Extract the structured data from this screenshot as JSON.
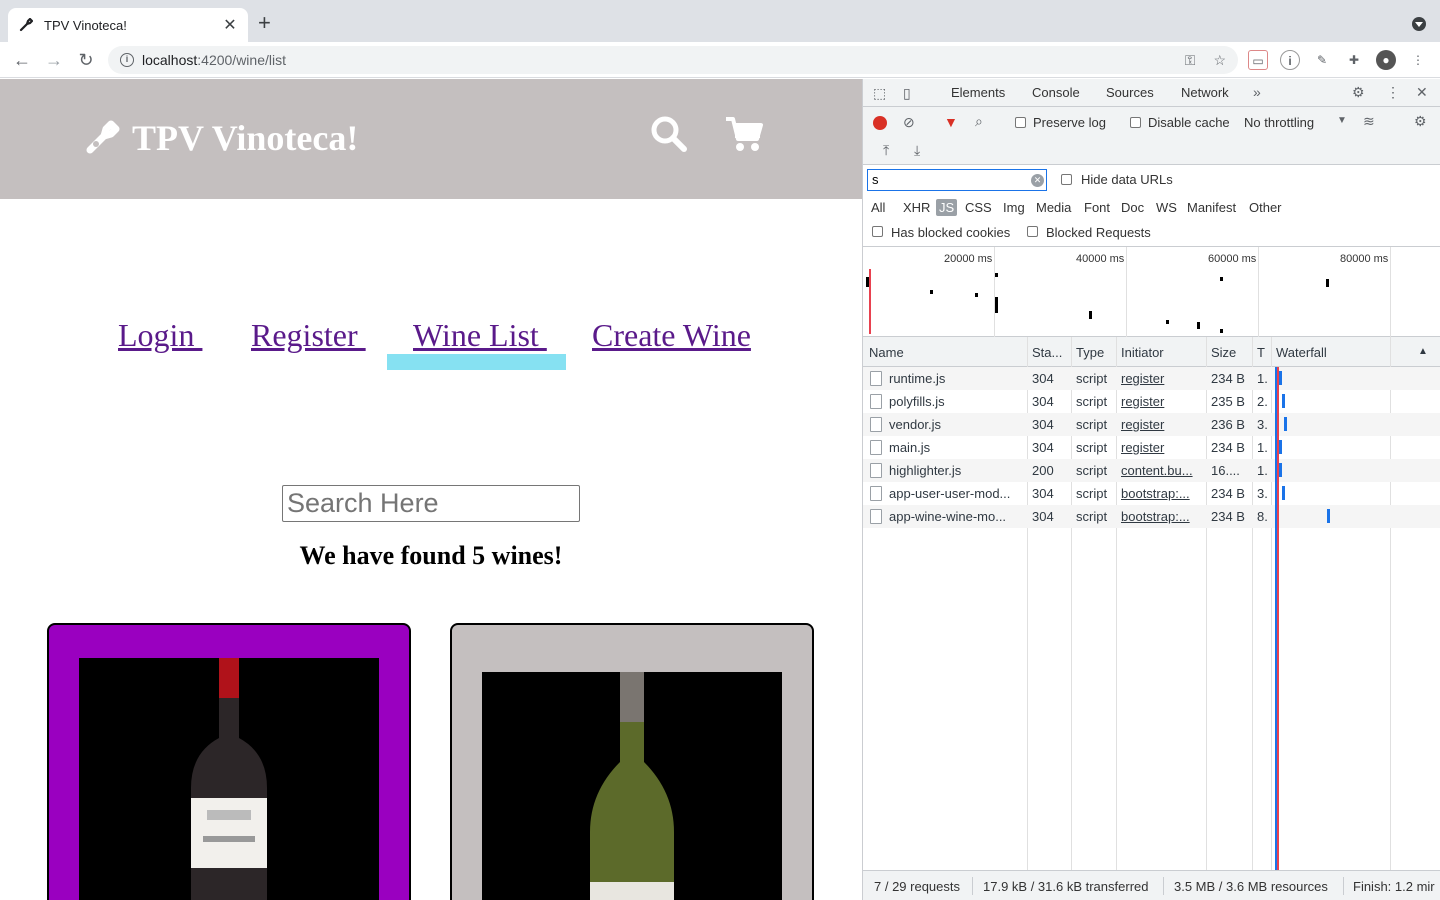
{
  "browser": {
    "tab_title": "TPV Vinoteca!",
    "url_host": "localhost",
    "url_path": ":4200/wine/list"
  },
  "site": {
    "brand": "TPV Vinoteca!",
    "nav": [
      "Login ",
      "Register ",
      "Wine List ",
      "Create Wine"
    ],
    "search_placeholder": "Search Here",
    "found_text": "We have found 5 wines!",
    "cards": [
      {
        "border": "#9a00c0"
      },
      {
        "border": "#c4bfbf"
      }
    ]
  },
  "devtools": {
    "tabs": [
      "Elements",
      "Console",
      "Sources",
      "Network"
    ],
    "active_tab": "Network",
    "preserve_log": "Preserve log",
    "disable_cache": "Disable cache",
    "throttling": "No throttling",
    "filter_value": "s",
    "hide_data_urls": "Hide data URLs",
    "types": [
      "All",
      "XHR",
      "JS",
      "CSS",
      "Img",
      "Media",
      "Font",
      "Doc",
      "WS",
      "Manifest",
      "Other"
    ],
    "active_type": "JS",
    "has_blocked_cookies": "Has blocked cookies",
    "blocked_requests": "Blocked Requests",
    "overview_ticks": [
      "20000 ms",
      "40000 ms",
      "60000 ms",
      "80000 ms"
    ],
    "columns": [
      "Name",
      "Sta...",
      "Type",
      "Initiator",
      "Size",
      "T",
      "Waterfall"
    ],
    "rows": [
      {
        "name": "runtime.js",
        "status": "304",
        "type": "script",
        "initiator": "register",
        "size": "234 B",
        "time": "1.",
        "wf": 0.0
      },
      {
        "name": "polyfills.js",
        "status": "304",
        "type": "script",
        "initiator": "register",
        "size": "235 B",
        "time": "2.",
        "wf": 0.02
      },
      {
        "name": "vendor.js",
        "status": "304",
        "type": "script",
        "initiator": "register",
        "size": "236 B",
        "time": "3.",
        "wf": 0.03
      },
      {
        "name": "main.js",
        "status": "304",
        "type": "script",
        "initiator": "register",
        "size": "234 B",
        "time": "1.",
        "wf": 0.0
      },
      {
        "name": "highlighter.js",
        "status": "200",
        "type": "script",
        "initiator": "content.bu...",
        "size": "16....",
        "time": "1.",
        "wf": 0.0
      },
      {
        "name": "app-user-user-mod...",
        "status": "304",
        "type": "script",
        "initiator": "bootstrap:...",
        "size": "234 B",
        "time": "3.",
        "wf": 0.02
      },
      {
        "name": "app-wine-wine-mo...",
        "status": "304",
        "type": "script",
        "initiator": "bootstrap:...",
        "size": "234 B",
        "time": "8.",
        "wf": 0.3
      }
    ],
    "status": {
      "requests": "7 / 29 requests",
      "transferred": "17.9 kB / 31.6 kB transferred",
      "resources": "3.5 MB / 3.6 MB resources",
      "finish": "Finish: 1.2 mir"
    }
  }
}
